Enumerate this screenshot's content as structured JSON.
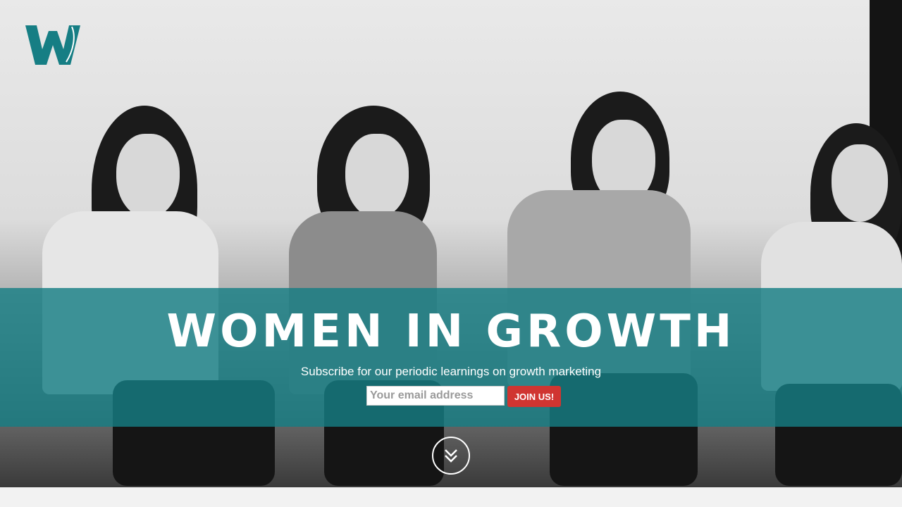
{
  "brand": {
    "logo_letter": "W",
    "accent_color": "#167e84"
  },
  "hero": {
    "headline": "WOMEN IN GROWTH",
    "subtitle": "Subscribe for our periodic learnings on growth marketing",
    "email_placeholder": "Your email address",
    "email_value": "",
    "join_label": "JOIN US!",
    "join_color": "#d03531",
    "scroll_icon": "double-chevron-down-icon"
  }
}
